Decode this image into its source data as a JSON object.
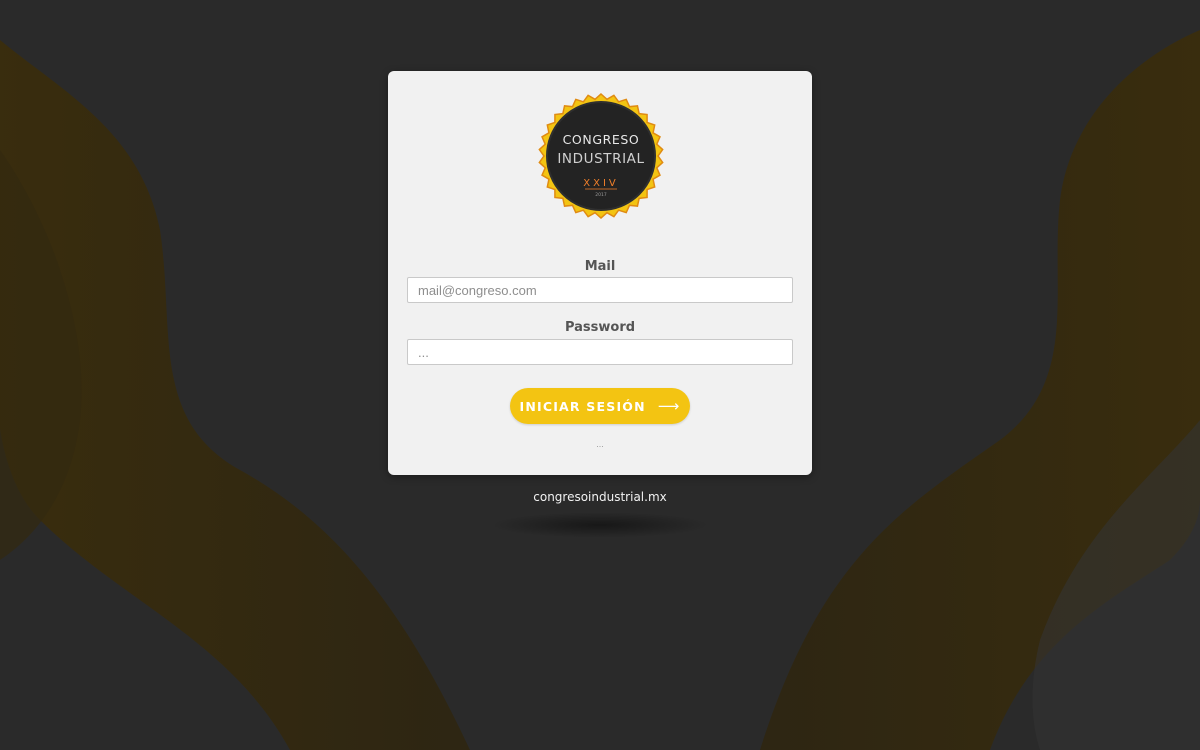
{
  "background": {
    "color": "#2a2a2a",
    "ribbon_color": "#3a2d0c"
  },
  "logo": {
    "line1": "CONGRESO",
    "line2": "INDUSTRIAL",
    "edition": "XXIV",
    "year": "2017",
    "ring_color": "#f3c412",
    "inner_color": "#232323"
  },
  "form": {
    "mail_label": "Mail",
    "mail_placeholder": "mail@congreso.com",
    "password_label": "Password",
    "password_placeholder": "...",
    "submit_label": "INICIAR SESIÓN",
    "submit_arrow": "⟶",
    "helper_text": "...",
    "accent_color": "#f3c412"
  },
  "footer": {
    "site": "congresoindustrial.mx"
  }
}
